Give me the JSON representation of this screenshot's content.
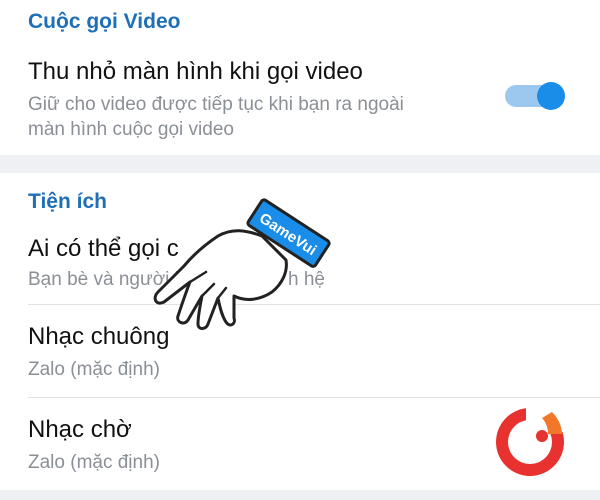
{
  "sections": {
    "video_call": {
      "header": "Cuộc gọi Video",
      "pip": {
        "title": "Thu nhỏ màn hình khi gọi video",
        "subtitle_line1": "Giữ cho video được tiếp tục khi bạn ra ngoài",
        "subtitle_line2": "màn hình cuộc gọi video",
        "toggle_on": true,
        "toggle_color": "#1a8de8"
      }
    },
    "utilities": {
      "header": "Tiện ích",
      "who_can_call": {
        "title_visible": "Ai có thể gọi c",
        "subtitle_left": "Bạn bè và người l",
        "subtitle_right": "h hệ"
      },
      "ringtone": {
        "title": "Nhạc chuông",
        "subtitle": "Zalo (mặc định)"
      },
      "ringback": {
        "title": "Nhạc chờ",
        "subtitle": "Zalo (mặc định)"
      }
    }
  },
  "overlay": {
    "hand_cuff_text": "GameVui",
    "hand_icon": "pointing-hand-icon",
    "logo_icon": "gamevui-logo-icon"
  },
  "colors": {
    "accent": "#1f6fb7",
    "section_band": "#eef0f3",
    "cuff": "#1a8de8",
    "logo_red": "#e8322f"
  }
}
